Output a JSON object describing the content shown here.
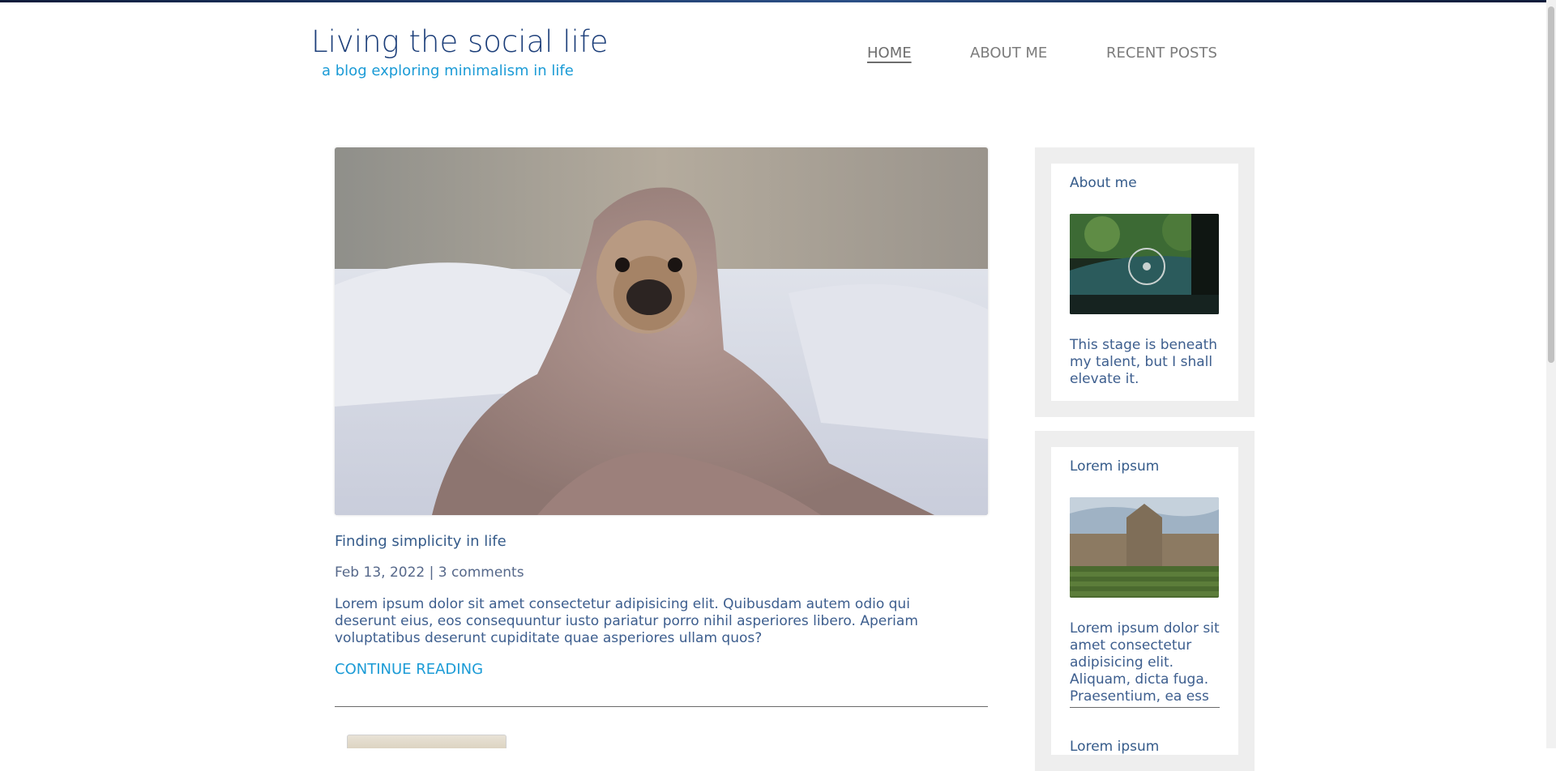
{
  "header": {
    "title": "Living the social life",
    "subtitle": "a blog exploring minimalism in life"
  },
  "nav": {
    "items": [
      {
        "label": "HOME",
        "active": true
      },
      {
        "label": "ABOUT ME",
        "active": false
      },
      {
        "label": "RECENT POSTS",
        "active": false
      }
    ]
  },
  "post": {
    "image_icon": "pug-in-blanket-photo",
    "title": "Finding simplicity in life",
    "meta": "Feb 13, 2022 | 3 comments",
    "excerpt": "Lorem ipsum dolor sit amet consectetur adipisicing elit. Quibusdam autem odio qui deserunt eius, eos consequuntur iusto pariatur porro nihil asperiores libero. Aperiam voluptatibus deserunt cupiditate quae asperiores ullam quos?",
    "continue_label": "CONTINUE READING"
  },
  "sidebar": {
    "widgets": [
      {
        "title": "About me",
        "image_icon": "vintage-car-interior-photo",
        "text": "This stage is beneath my talent, but I shall elevate it."
      },
      {
        "title": "Lorem ipsum",
        "image_icon": "college-building-photo",
        "text": "Lorem ipsum dolor sit amet consectetur adipisicing elit. Aliquam, dicta fuga. Praesentium, ea ess",
        "next_title": "Lorem ipsum"
      }
    ]
  },
  "colors": {
    "title": "#1d3f7a",
    "accent": "#1b9bd6",
    "text": "#3d5e8e",
    "nav": "#7c7c7c",
    "sidebar_bg": "#eeeeee"
  }
}
